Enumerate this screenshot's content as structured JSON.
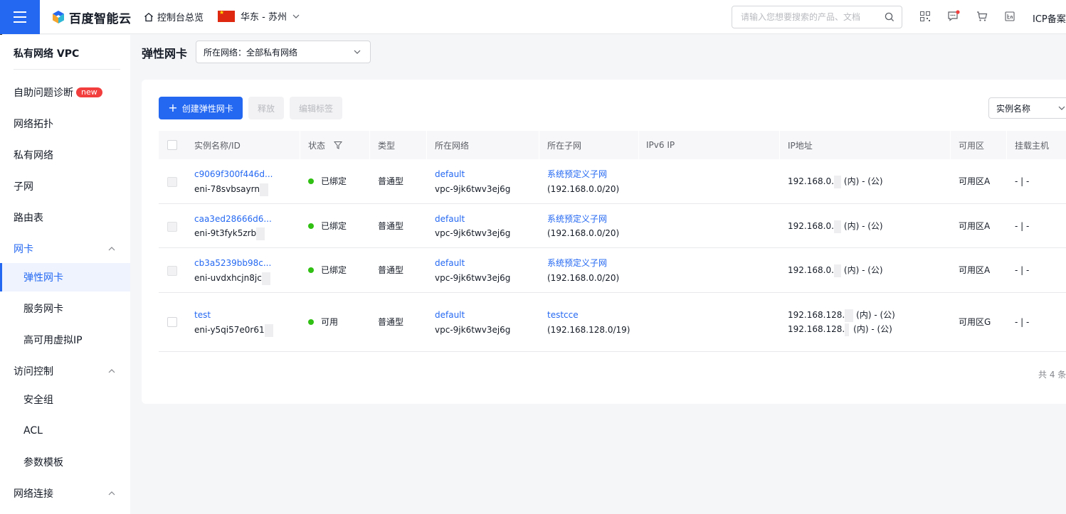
{
  "topbar": {
    "logo_text": "百度智能云",
    "overview_label": "控制台总览",
    "region_label": "华东 - 苏州",
    "search_placeholder": "请输入您想要搜索的产品、文档",
    "icp_label": "ICP备案"
  },
  "sidebar": {
    "title": "私有网络 VPC",
    "new_badge": "new",
    "items": [
      {
        "label": "自助问题诊断"
      },
      {
        "label": "网络拓扑"
      },
      {
        "label": "私有网络"
      },
      {
        "label": "子网"
      },
      {
        "label": "路由表"
      },
      {
        "label": "网卡"
      },
      {
        "label": "弹性网卡"
      },
      {
        "label": "服务网卡"
      },
      {
        "label": "高可用虚拟IP"
      },
      {
        "label": "访问控制"
      },
      {
        "label": "安全组"
      },
      {
        "label": "ACL"
      },
      {
        "label": "参数模板"
      },
      {
        "label": "网络连接"
      }
    ]
  },
  "header": {
    "title": "弹性网卡",
    "network_select": "所在网络：全部私有网络"
  },
  "toolbar": {
    "create_label": "创建弹性网卡",
    "release_label": "释放",
    "edit_tags_label": "编辑标签",
    "filter_select": "实例名称"
  },
  "table": {
    "columns": [
      "实例名称/ID",
      "状态",
      "类型",
      "所在网络",
      "所在子网",
      "IPv6 IP",
      "IP地址",
      "可用区",
      "挂载主机"
    ],
    "rows": [
      {
        "name": "c9069f300f446d...",
        "id": "eni-78svbsayrn",
        "status": "已绑定",
        "type": "普通型",
        "vpc_name": "default",
        "vpc_id": "vpc-9jk6twv3ej6g",
        "subnet_name": "系统预定义子网",
        "subnet_cidr": "(192.168.0.0/20)",
        "ipv6": "",
        "ip1_prefix": "192.168.0.",
        "ip1_suffix": "(内) - (公)",
        "zone": "可用区A",
        "host": "- | -"
      },
      {
        "name": "caa3ed28666d6...",
        "id": "eni-9t3fyk5zrb",
        "status": "已绑定",
        "type": "普通型",
        "vpc_name": "default",
        "vpc_id": "vpc-9jk6twv3ej6g",
        "subnet_name": "系统预定义子网",
        "subnet_cidr": "(192.168.0.0/20)",
        "ipv6": "",
        "ip1_prefix": "192.168.0.",
        "ip1_suffix": "(内) - (公)",
        "zone": "可用区A",
        "host": "- | -"
      },
      {
        "name": "cb3a5239bb98c...",
        "id": "eni-uvdxhcjn8jc",
        "status": "已绑定",
        "type": "普通型",
        "vpc_name": "default",
        "vpc_id": "vpc-9jk6twv3ej6g",
        "subnet_name": "系统预定义子网",
        "subnet_cidr": "(192.168.0.0/20)",
        "ipv6": "",
        "ip1_prefix": "192.168.0.",
        "ip1_suffix": "(内) - (公)",
        "zone": "可用区A",
        "host": "- | -"
      },
      {
        "name": "test",
        "id": "eni-y5qi57e0r61",
        "status": "可用",
        "type": "普通型",
        "vpc_name": "default",
        "vpc_id": "vpc-9jk6twv3ej6g",
        "subnet_name": "testcce",
        "subnet_cidr": "(192.168.128.0/19)",
        "ipv6": "",
        "ip1_prefix": "192.168.128.",
        "ip1_suffix": "(内) - (公)",
        "ip2_prefix": "192.168.128.",
        "ip2_suffix": "(内) - (公)",
        "zone": "可用区G",
        "host": "- | -"
      }
    ],
    "total": "共 4 条"
  },
  "colors": {
    "primary": "#2468f2",
    "status_green": "#30bf13",
    "badge_red": "#f33e3e"
  }
}
